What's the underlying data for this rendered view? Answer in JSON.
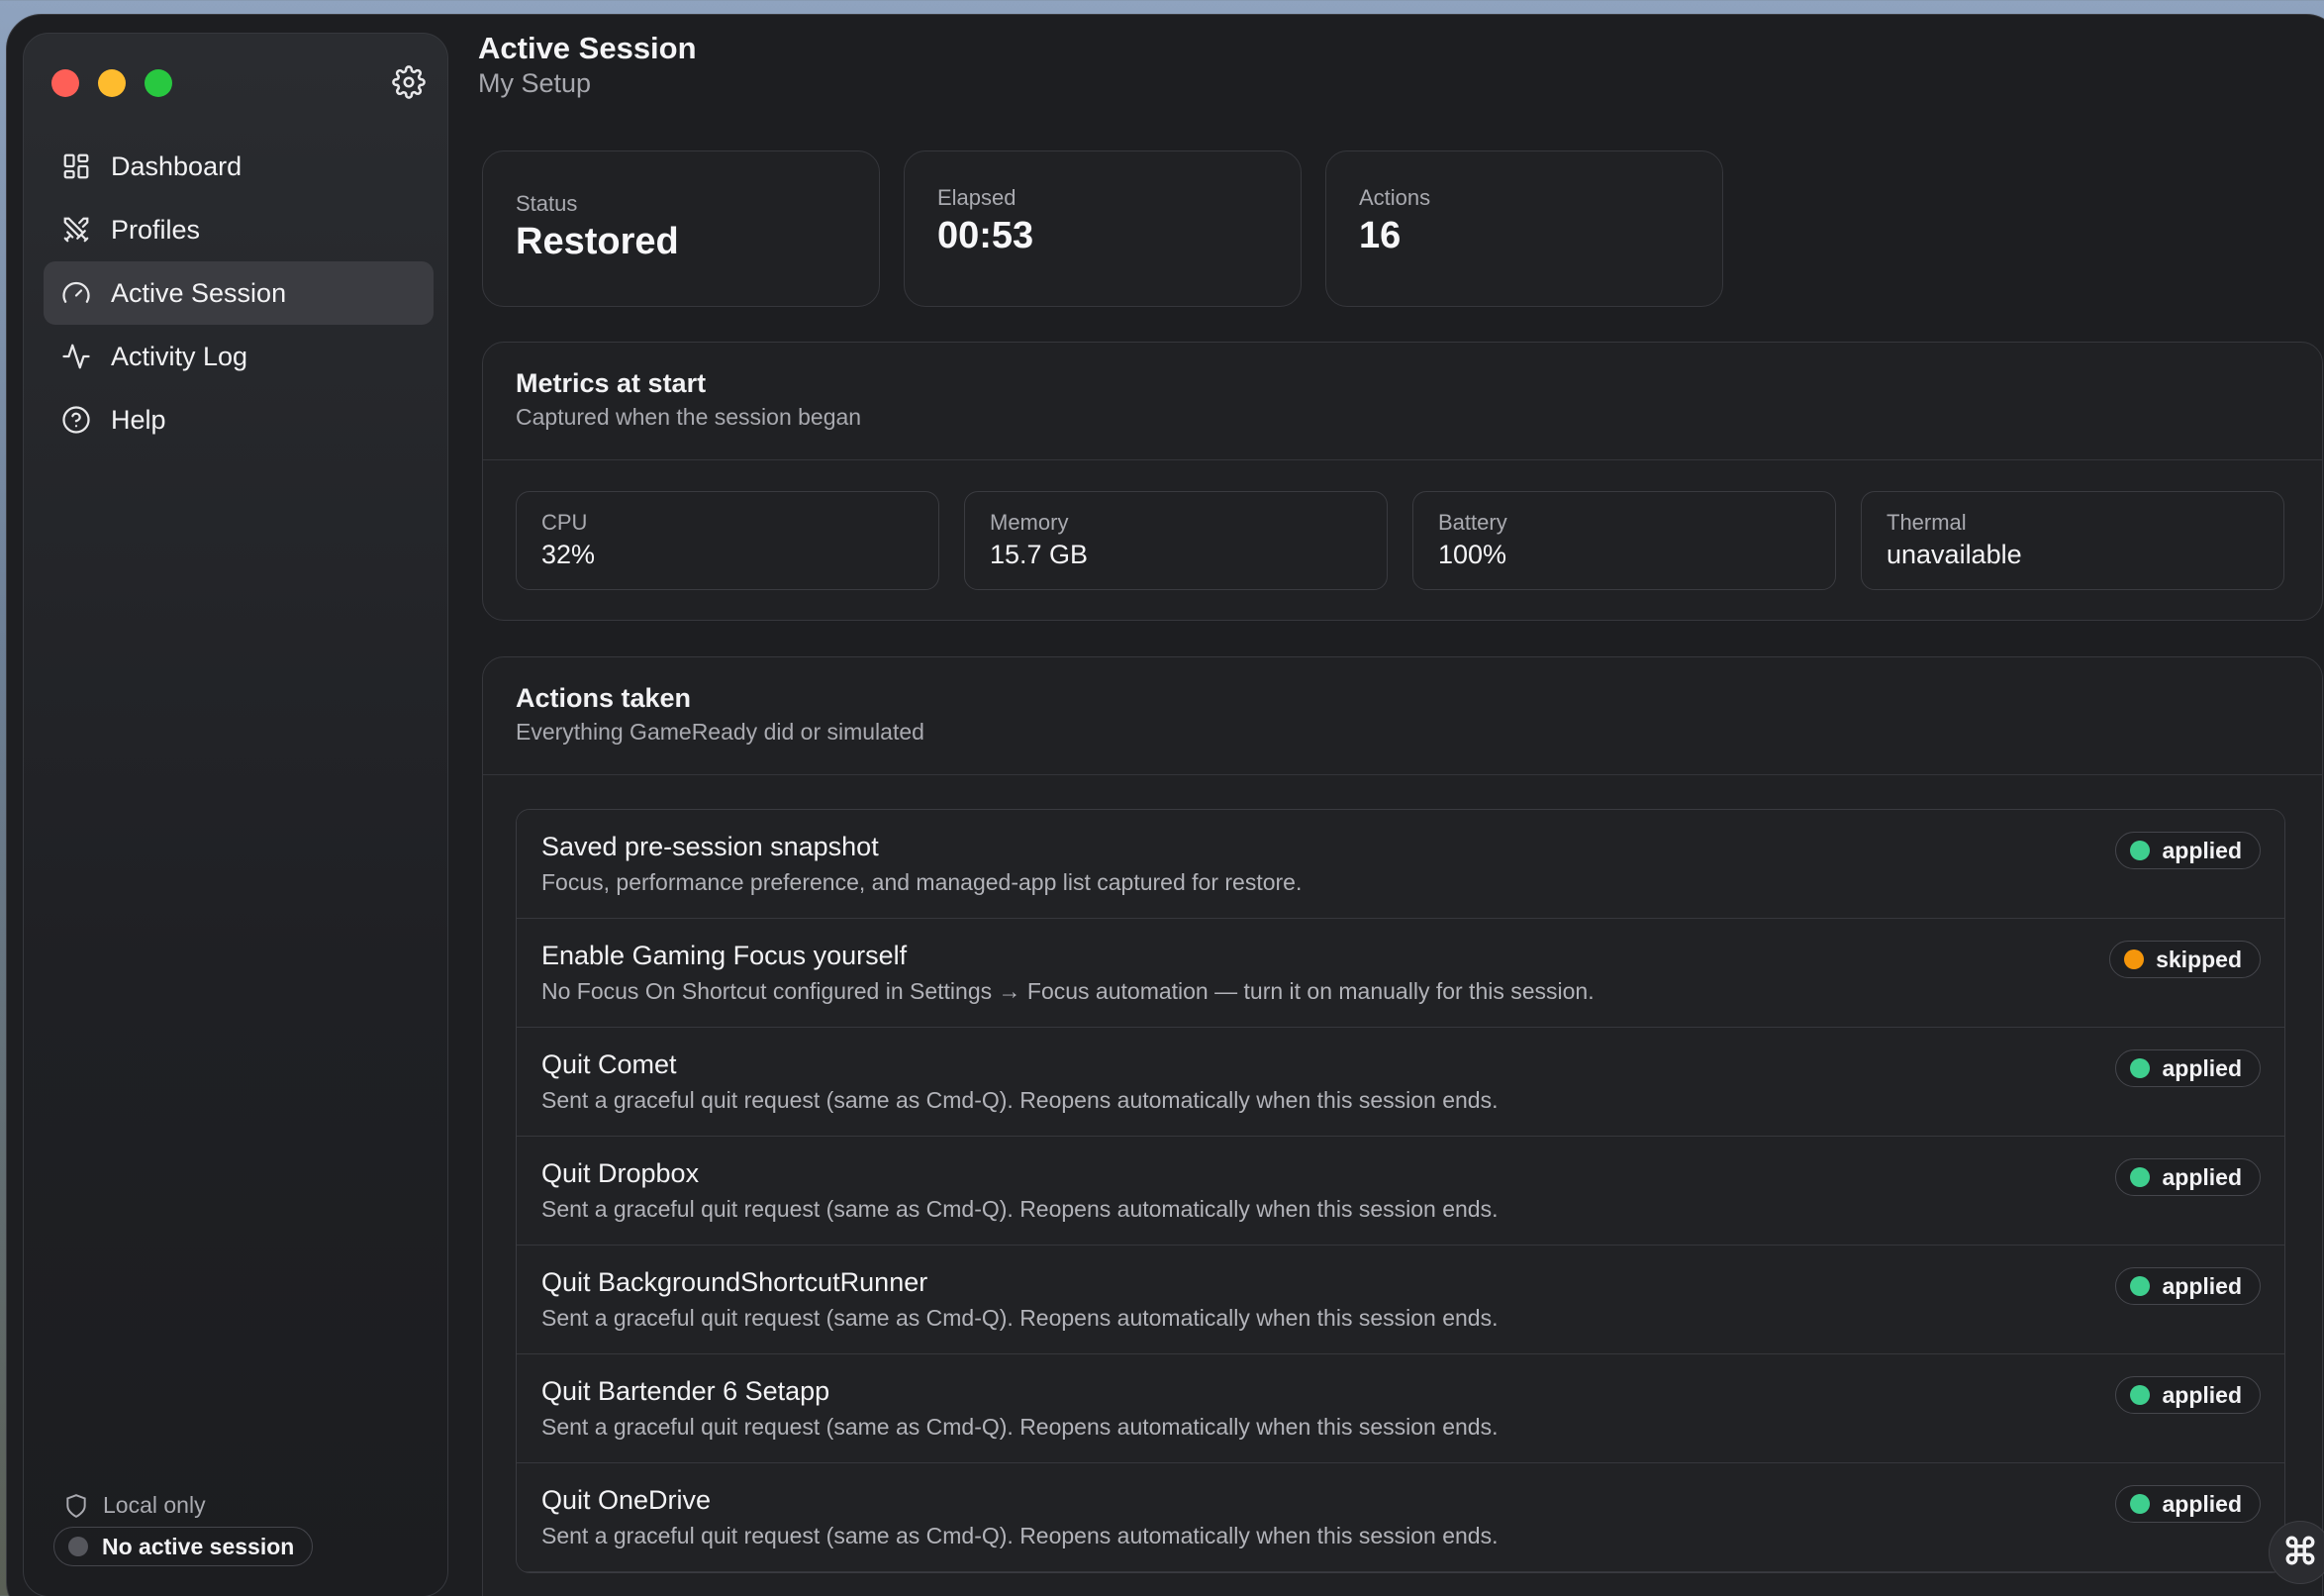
{
  "sidebar": {
    "items": [
      {
        "label": "Dashboard",
        "icon": "dashboard-icon"
      },
      {
        "label": "Profiles",
        "icon": "profiles-icon"
      },
      {
        "label": "Active Session",
        "icon": "gauge-icon",
        "active": true
      },
      {
        "label": "Activity Log",
        "icon": "activity-icon"
      },
      {
        "label": "Help",
        "icon": "help-icon"
      }
    ],
    "footer": {
      "local_label": "Local only",
      "session_label": "No active session"
    }
  },
  "header": {
    "title": "Active Session",
    "subtitle": "My Setup"
  },
  "stats": {
    "status": {
      "label": "Status",
      "value": "Restored"
    },
    "elapsed": {
      "label": "Elapsed",
      "value": "00:53"
    },
    "actions": {
      "label": "Actions",
      "value": "16"
    }
  },
  "metrics": {
    "title": "Metrics at start",
    "subtitle": "Captured when the session began",
    "items": [
      {
        "label": "CPU",
        "value": "32%"
      },
      {
        "label": "Memory",
        "value": "15.7 GB"
      },
      {
        "label": "Battery",
        "value": "100%"
      },
      {
        "label": "Thermal",
        "value": "unavailable"
      }
    ]
  },
  "actions_taken": {
    "title": "Actions taken",
    "subtitle": "Everything GameReady did or simulated",
    "rows": [
      {
        "title": "Saved pre-session snapshot",
        "desc": "Focus, performance preference, and managed-app list captured for restore.",
        "status": "applied"
      },
      {
        "title": "Enable Gaming Focus yourself",
        "desc": "No Focus On Shortcut configured in Settings → Focus automation — turn it on manually for this session.",
        "status": "skipped"
      },
      {
        "title": "Quit Comet",
        "desc": "Sent a graceful quit request (same as Cmd-Q). Reopens automatically when this session ends.",
        "status": "applied"
      },
      {
        "title": "Quit Dropbox",
        "desc": "Sent a graceful quit request (same as Cmd-Q). Reopens automatically when this session ends.",
        "status": "applied"
      },
      {
        "title": "Quit BackgroundShortcutRunner",
        "desc": "Sent a graceful quit request (same as Cmd-Q). Reopens automatically when this session ends.",
        "status": "applied"
      },
      {
        "title": "Quit Bartender 6 Setapp",
        "desc": "Sent a graceful quit request (same as Cmd-Q). Reopens automatically when this session ends.",
        "status": "applied"
      },
      {
        "title": "Quit OneDrive",
        "desc": "Sent a graceful quit request (same as Cmd-Q). Reopens automatically when this session ends.",
        "status": "applied"
      }
    ]
  },
  "colors": {
    "applied": "#3ecf8e",
    "skipped": "#f5960b",
    "active_nav": "#3b3c41"
  }
}
